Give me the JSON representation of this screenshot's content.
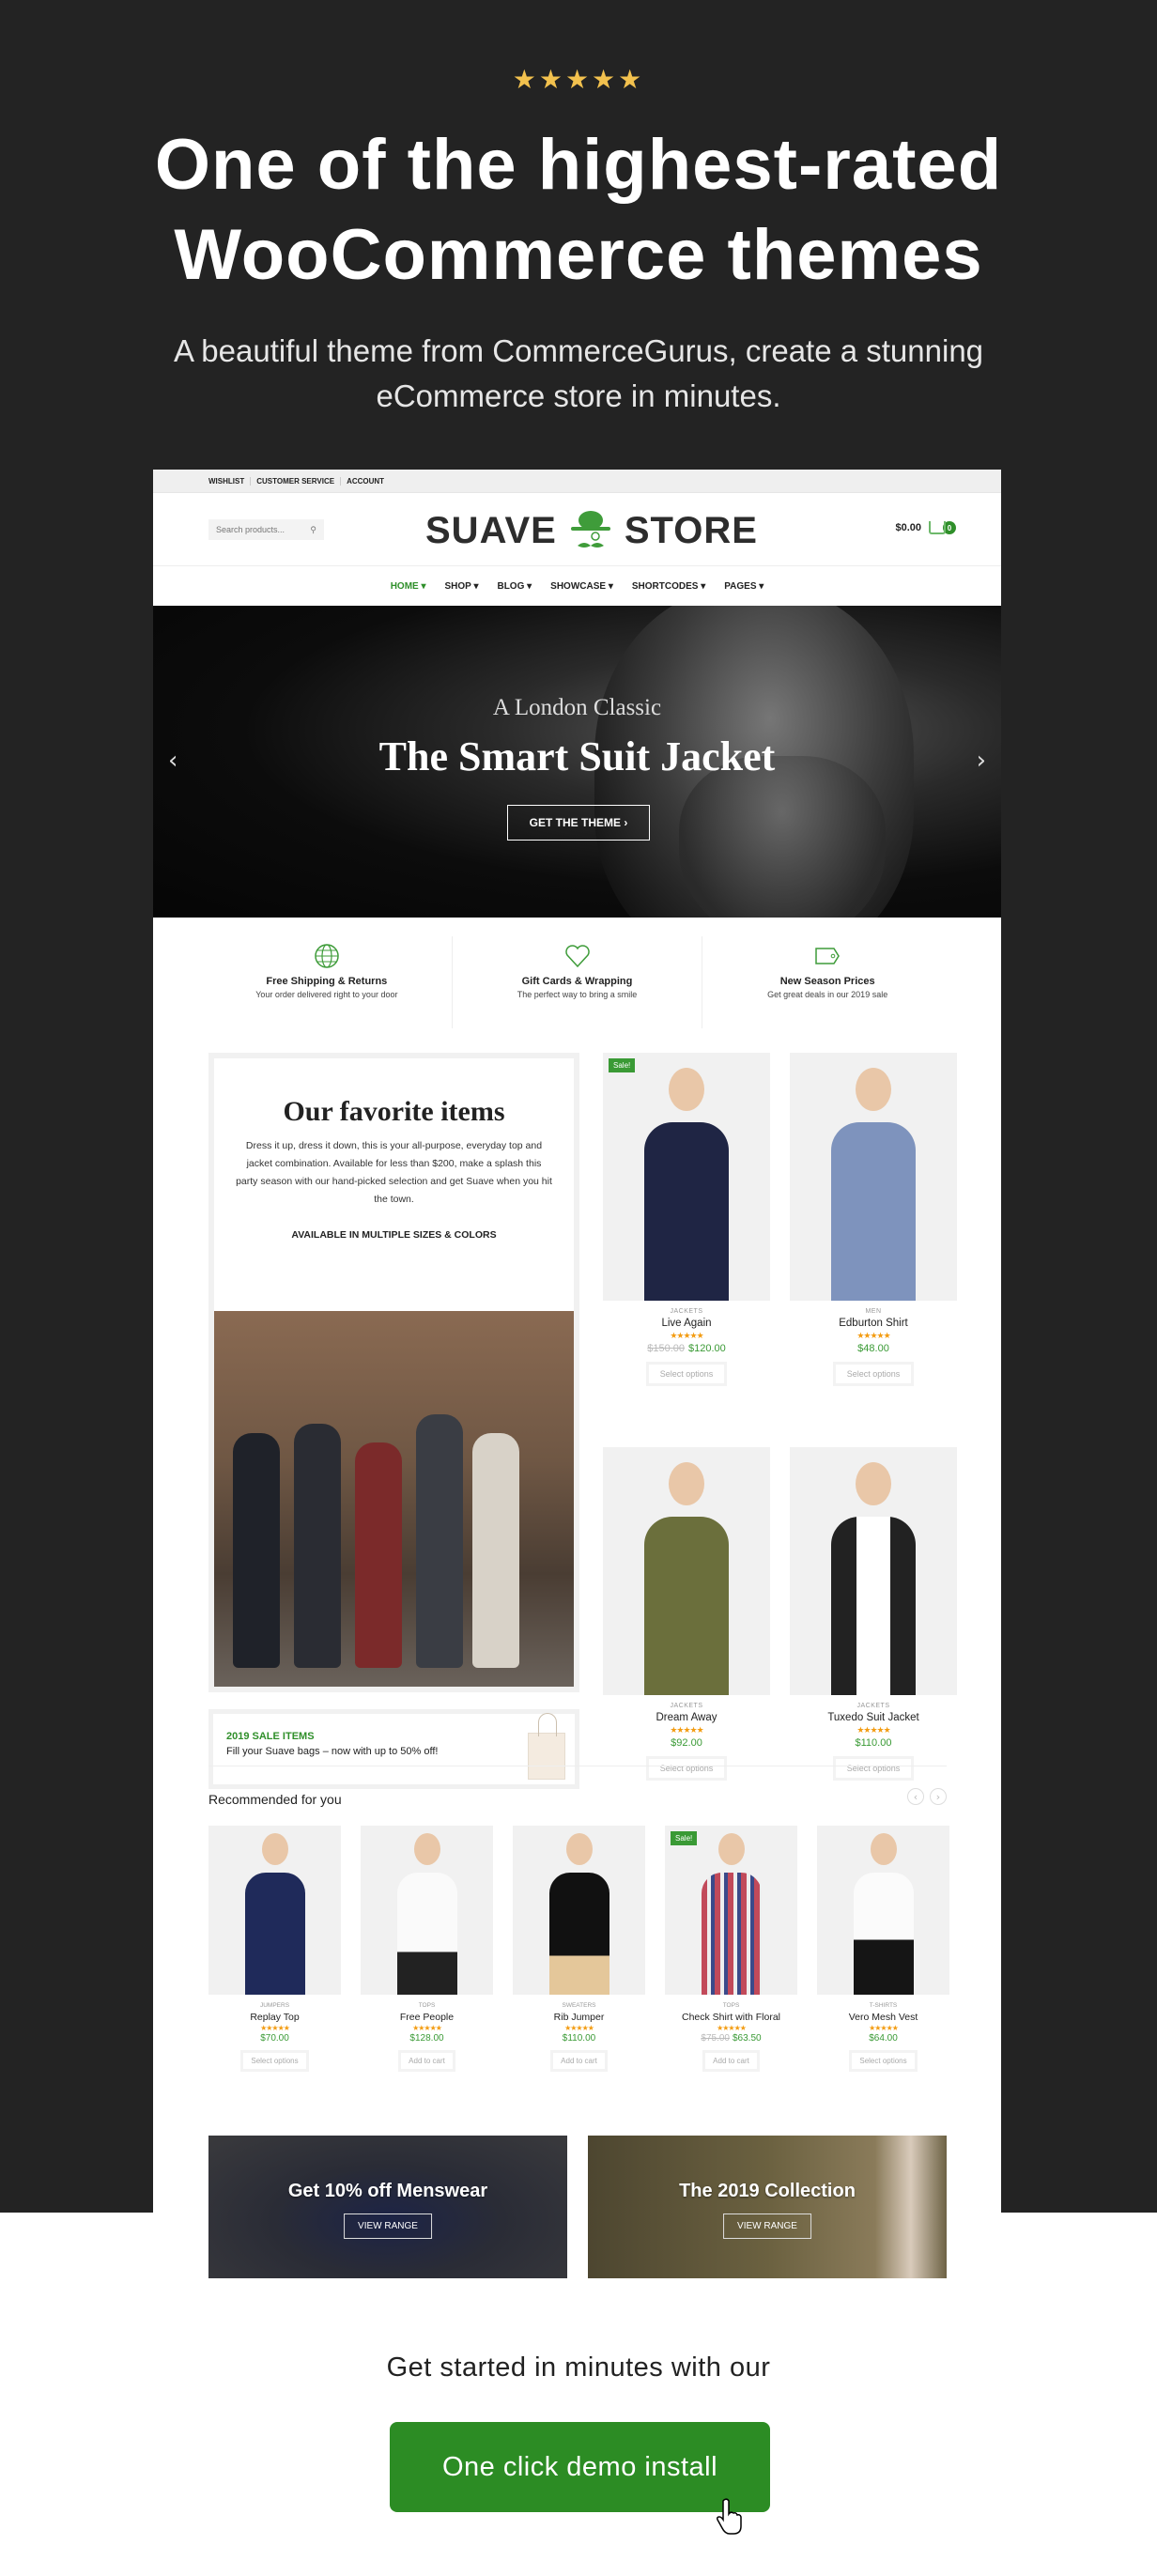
{
  "rating_stars": "★★★★★",
  "headline": "One of the highest-rated WooCommerce themes",
  "subheadline": "A beautiful theme from CommerceGurus, create a stunning eCommerce store in minutes.",
  "store": {
    "topbar_links": [
      "WISHLIST",
      "CUSTOMER SERVICE",
      "ACCOUNT"
    ],
    "search_placeholder": "Search products...",
    "logo_left": "SUAVE",
    "logo_right": "STORE",
    "cart_total": "$0.00",
    "cart_count": "0",
    "nav": [
      "HOME ▾",
      "SHOP ▾",
      "BLOG ▾",
      "SHOWCASE ▾",
      "SHORTCODES ▾",
      "PAGES ▾"
    ],
    "banner": {
      "kicker": "A London Classic",
      "title": "The Smart Suit Jacket",
      "button": "GET THE THEME ›",
      "prev": "‹",
      "next": "›"
    },
    "features": [
      {
        "icon": "globe-icon",
        "title": "Free Shipping & Returns",
        "subtitle": "Your order delivered right to your door"
      },
      {
        "icon": "heart-icon",
        "title": "Gift Cards & Wrapping",
        "subtitle": "The perfect way to bring a smile"
      },
      {
        "icon": "tag-icon",
        "title": "New Season Prices",
        "subtitle": "Get great deals in our 2019 sale"
      }
    ],
    "favorites": {
      "title": "Our favorite items",
      "body": "Dress it up, dress it down, this is your all-purpose, everyday top and jacket combination. Available for less than $200, make a splash this party season with our hand-picked selection and get Suave when you hit the town.",
      "tagline": "AVAILABLE IN MULTIPLE SIZES & COLORS"
    },
    "sale_box": {
      "title": "2019 SALE ITEMS",
      "text": "Fill your Suave bags – now with up to 50% off!"
    },
    "featured_products": [
      {
        "category": "JACKETS",
        "name": "Live Again",
        "rating": "★★★★★",
        "old_price": "$150.00",
        "price": "$120.00",
        "button": "Select options",
        "sale": "Sale!"
      },
      {
        "category": "MEN",
        "name": "Edburton Shirt",
        "rating": "★★★★★",
        "old_price": "",
        "price": "$48.00",
        "button": "Select options",
        "sale": ""
      },
      {
        "category": "JACKETS",
        "name": "Dream Away",
        "rating": "★★★★★",
        "old_price": "",
        "price": "$92.00",
        "button": "Select options",
        "sale": ""
      },
      {
        "category": "JACKETS",
        "name": "Tuxedo Suit Jacket",
        "rating": "★★★★★",
        "old_price": "",
        "price": "$110.00",
        "button": "Select options",
        "sale": ""
      }
    ],
    "recommended": {
      "title": "Recommended for you",
      "prev": "‹",
      "next": "›",
      "items": [
        {
          "category": "JUMPERS",
          "name": "Replay Top",
          "rating": "★★★★★",
          "old_price": "",
          "price": "$70.00",
          "button": "Select options",
          "sale": ""
        },
        {
          "category": "TOPS",
          "name": "Free People",
          "rating": "★★★★★",
          "old_price": "",
          "price": "$128.00",
          "button": "Add to cart",
          "sale": ""
        },
        {
          "category": "SWEATERS",
          "name": "Rib Jumper",
          "rating": "★★★★★",
          "old_price": "",
          "price": "$110.00",
          "button": "Add to cart",
          "sale": ""
        },
        {
          "category": "TOPS",
          "name": "Check Shirt with Floral",
          "rating": "★★★★★",
          "old_price": "$75.00",
          "price": "$63.50",
          "button": "Add to cart",
          "sale": "Sale!"
        },
        {
          "category": "T-SHIRTS",
          "name": "Vero Mesh Vest",
          "rating": "★★★★★",
          "old_price": "",
          "price": "$64.00",
          "button": "Select options",
          "sale": ""
        }
      ]
    },
    "promos": [
      {
        "title": "Get 10% off Menswear",
        "button": "VIEW RANGE"
      },
      {
        "title": "The 2019 Collection",
        "button": "VIEW RANGE"
      }
    ]
  },
  "cta": {
    "text": "Get started in minutes with our",
    "button": "One click demo install"
  },
  "colors": {
    "brand_green": "#2c8c24",
    "dark_bg": "#232323",
    "star_gold": "#f2c14e"
  }
}
